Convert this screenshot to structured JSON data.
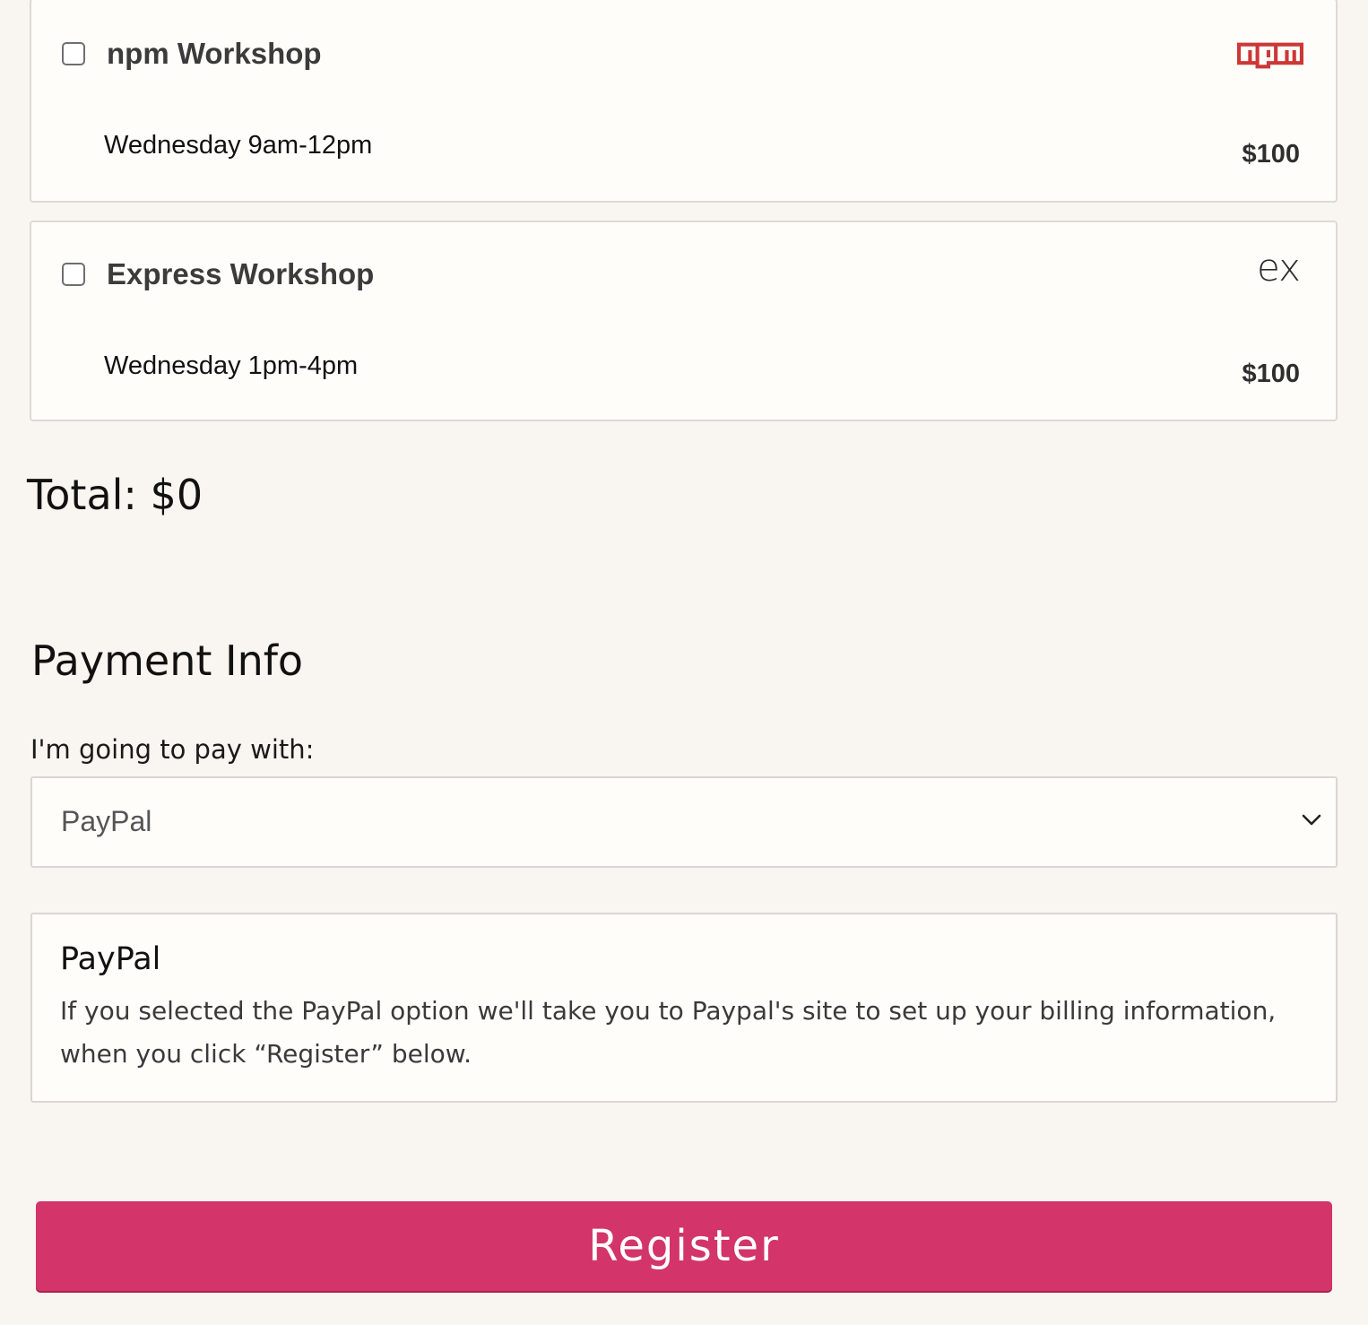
{
  "workshops": [
    {
      "title": "npm Workshop",
      "time": "Wednesday 9am-12pm",
      "price": "$100",
      "checked": false,
      "logo": "npm-logo",
      "logo_color": "#cb3837"
    },
    {
      "title": "Express Workshop",
      "time": "Wednesday 1pm-4pm",
      "price": "$100",
      "checked": false,
      "logo": "ex",
      "logo_text": "ex"
    }
  ],
  "total": "Total: $0",
  "payment": {
    "heading": "Payment Info",
    "method_label": "I'm going to pay with:",
    "selected_method": "PayPal",
    "info_title": "PayPal",
    "info_text": "If you selected the PayPal option we'll take you to Paypal's site to set up your billing information, when you click “Register” below."
  },
  "register_label": "Register",
  "colors": {
    "background": "#f9f5f0",
    "card": "#fefdf9",
    "accent": "#d3346a",
    "npm_red": "#cb3837"
  }
}
